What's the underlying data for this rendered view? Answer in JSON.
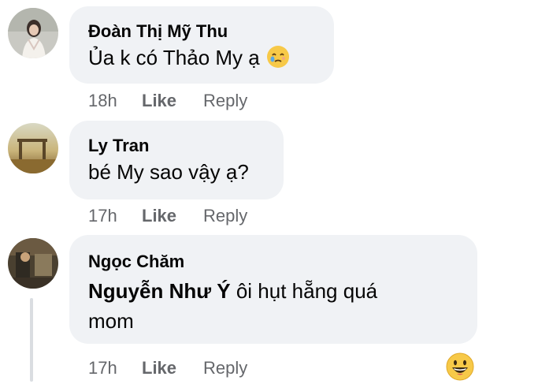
{
  "comments": [
    {
      "author": "Đoàn Thị Mỹ Thu",
      "text": "Ủa k có Thảo My ạ",
      "emoji": "crying-face-emoji",
      "time": "18h",
      "like_label": "Like",
      "reply_label": "Reply"
    },
    {
      "author": "Ly Tran",
      "text": "bé My sao vậy ạ?",
      "time": "17h",
      "like_label": "Like",
      "reply_label": "Reply"
    },
    {
      "author": "Ngọc Chăm",
      "mention": "Nguyễn Như Ý",
      "text_line1": " ôi hụt hẵng quá",
      "text_line2": "mom",
      "time": "17h",
      "like_label": "Like",
      "reply_label": "Reply",
      "reaction": "grinning-face-emoji"
    }
  ],
  "colors": {
    "bubble": "#f0f2f5",
    "meta_text": "#65676b",
    "text": "#050505",
    "thread_line": "#dadde1"
  }
}
